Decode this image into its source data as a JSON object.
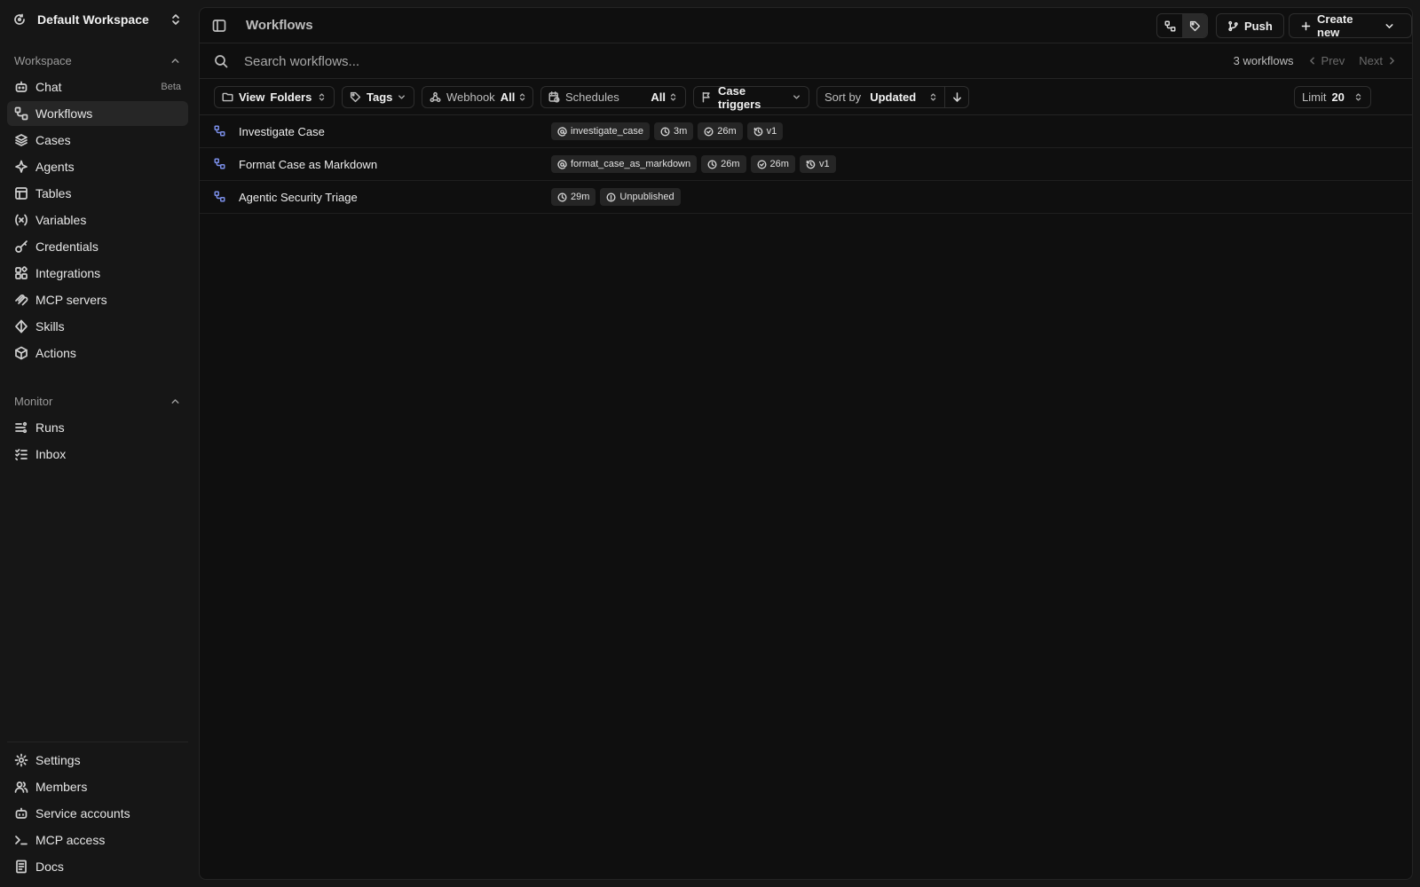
{
  "workspace": {
    "name": "Default Workspace"
  },
  "sidebar": {
    "workspace_section": "Workspace",
    "monitor_section": "Monitor",
    "items": [
      {
        "label": "Chat",
        "badge": "Beta",
        "icon": "chat-bot-icon"
      },
      {
        "label": "Workflows",
        "icon": "workflow-icon"
      },
      {
        "label": "Cases",
        "icon": "layers-icon"
      },
      {
        "label": "Agents",
        "icon": "agent-icon"
      },
      {
        "label": "Tables",
        "icon": "table-icon"
      },
      {
        "label": "Variables",
        "icon": "variable-icon"
      },
      {
        "label": "Credentials",
        "icon": "key-icon"
      },
      {
        "label": "Integrations",
        "icon": "integrations-icon"
      },
      {
        "label": "MCP servers",
        "icon": "mcp-icon"
      },
      {
        "label": "Skills",
        "icon": "skills-icon"
      },
      {
        "label": "Actions",
        "icon": "cube-icon"
      }
    ],
    "monitor_items": [
      {
        "label": "Runs",
        "icon": "runs-icon"
      },
      {
        "label": "Inbox",
        "icon": "inbox-icon"
      }
    ],
    "bottom_items": [
      {
        "label": "Settings",
        "icon": "gear-icon"
      },
      {
        "label": "Members",
        "icon": "users-icon"
      },
      {
        "label": "Service accounts",
        "icon": "bot-icon"
      },
      {
        "label": "MCP access",
        "icon": "terminal-icon"
      },
      {
        "label": "Docs",
        "icon": "book-icon"
      }
    ]
  },
  "header": {
    "title": "Workflows",
    "push_label": "Push",
    "create_label": "Create new"
  },
  "search": {
    "placeholder": "Search workflows...",
    "count": "3 workflows",
    "prev": "Prev",
    "next": "Next"
  },
  "filters": {
    "view_key": "View",
    "view_value": "Folders",
    "tags": "Tags",
    "webhook_key": "Webhook",
    "webhook_value": "All",
    "schedules_key": "Schedules",
    "schedules_value": "All",
    "case_triggers": "Case triggers",
    "sort_key": "Sort by",
    "sort_value": "Updated",
    "limit_key": "Limit",
    "limit_value": "20"
  },
  "workflows": [
    {
      "name": "Investigate Case",
      "alias": "investigate_case",
      "updated": "3m",
      "created": "26m",
      "version": "v1"
    },
    {
      "name": "Format Case as Markdown",
      "alias": "format_case_as_markdown",
      "updated": "26m",
      "created": "26m",
      "version": "v1"
    },
    {
      "name": "Agentic Security Triage",
      "updated": "29m",
      "status": "Unpublished"
    }
  ]
}
